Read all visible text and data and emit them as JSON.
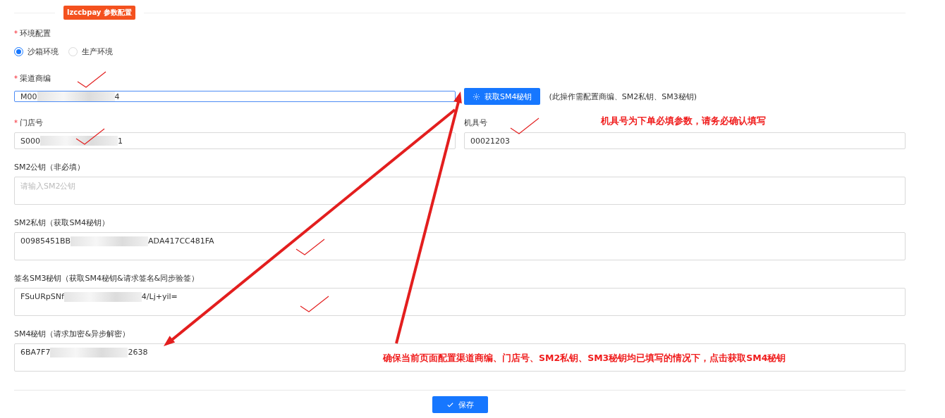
{
  "section_badge": "lzccbpay 参数配置",
  "required_mark": "*",
  "environment": {
    "label": "环境配置",
    "required": true,
    "options": [
      {
        "label": "沙箱环境",
        "selected": true
      },
      {
        "label": "生产环境",
        "selected": false
      }
    ]
  },
  "channel_merchant": {
    "label": "渠道商编",
    "required": true,
    "focused": true,
    "value_parts": [
      "M00",
      "4"
    ]
  },
  "fetch_button": {
    "label": "获取SM4秘钥"
  },
  "fetch_hint": "(此操作需配置商编、SM2私钥、SM3秘钥)",
  "store_no": {
    "label": "门店号",
    "required": true,
    "value_parts": [
      "S000",
      "1"
    ]
  },
  "terminal_no": {
    "label": "机具号",
    "value_parts": [
      "00021203"
    ]
  },
  "textareas": [
    {
      "label": "SM2公钥（非必填）",
      "placeholder": "请输入SM2公钥"
    },
    {
      "label": "SM2私钥（获取SM4秘钥）",
      "value_parts": [
        "00985451BB",
        "ADA417CC481FA"
      ]
    },
    {
      "label": "签名SM3秘钥（获取SM4秘钥&请求签名&同步验签）",
      "value_parts": [
        "FSuURpSNf",
        "4/Lj+yil="
      ]
    },
    {
      "label": "SM4秘钥（请求加密&异步解密）",
      "value_parts": [
        "6BA7F7",
        "2638"
      ]
    }
  ],
  "notes": [
    "机具号为下单必填参数，请务必确认填写",
    "确保当前页面配置渠道商编、门店号、SM2私钥、SM3秘钥均已填写的情况下，点击获取SM4秘钥"
  ],
  "save_button": {
    "label": "保存"
  }
}
